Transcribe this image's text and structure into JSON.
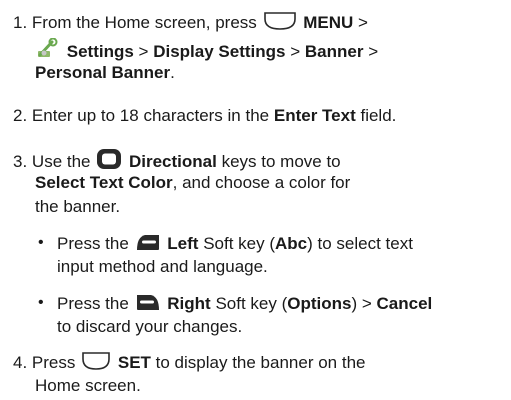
{
  "steps": [
    {
      "number": "1.",
      "intro": "From the Home screen, press",
      "menu_key": "MENU",
      "gt": ">",
      "path_settings": "Settings",
      "sep": ">",
      "path_display": "Display Settings",
      "path_banner": "Banner",
      "path_personal": "Personal Banner",
      "end": "."
    },
    {
      "number": "2.",
      "intro": "Enter up to 18 characters in the",
      "field": "Enter Text",
      "end": "field."
    },
    {
      "number": "3.",
      "intro": "Use the",
      "keys": "Directional",
      "mid": "keys to move to",
      "target": "Select Text Color",
      "rest1": ", and choose a color for",
      "rest2": "the banner.",
      "bullets": [
        {
          "prefix": "Press the",
          "key": "Left",
          "mid": "Soft key (",
          "paren": "Abc",
          "rest1": ") to select text",
          "rest2": "input method and language."
        },
        {
          "prefix": "Press the",
          "key": "Right",
          "mid": "Soft key (",
          "paren": "Options",
          "gt": ") >",
          "cancel": "Cancel",
          "rest2": "to discard your changes."
        }
      ]
    },
    {
      "number": "4.",
      "intro": "Press",
      "set_key": "SET",
      "rest1": "to display the banner on the",
      "rest2": "Home screen."
    }
  ],
  "icons": {
    "menu_key": "center-select-key-icon",
    "settings": "settings-wrench-icon",
    "directional": "directional-pad-icon",
    "left_soft": "left-soft-key-icon",
    "right_soft": "right-soft-key-icon",
    "set_key": "center-select-key-icon"
  },
  "colors": {
    "text": "#1a1a1a",
    "key_fill": "#2a2a2a",
    "settings_green": "#6aa84f"
  }
}
